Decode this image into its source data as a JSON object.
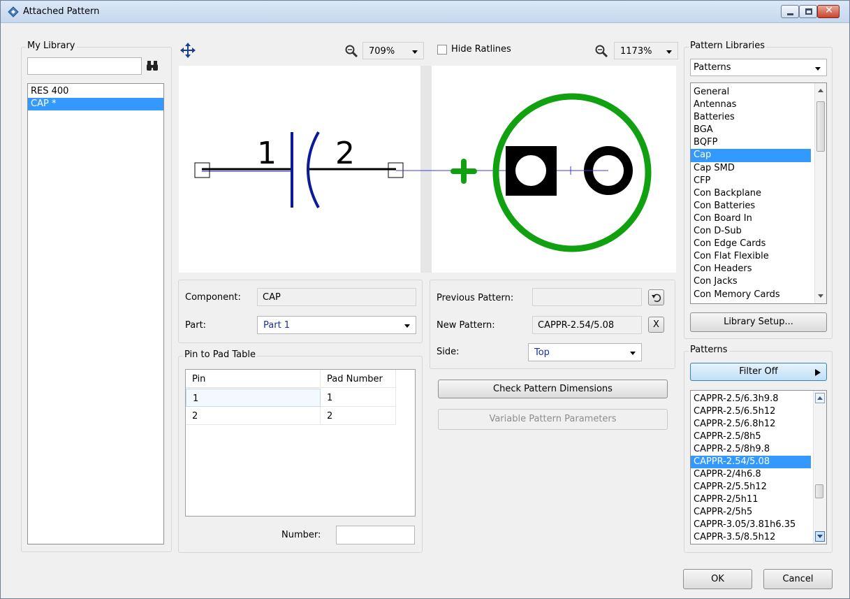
{
  "window": {
    "title": "Attached Pattern"
  },
  "my_library": {
    "group_label": "My Library",
    "search_value": "",
    "items": [
      {
        "label": "RES 400",
        "selected": false
      },
      {
        "label": "CAP *",
        "selected": true
      }
    ]
  },
  "toolbar": {
    "left_zoom": "709%",
    "hide_ratlines_label": "Hide Ratlines",
    "hide_ratlines_checked": false,
    "right_zoom": "1173%"
  },
  "schematic": {
    "pin1_label": "1",
    "pin2_label": "2"
  },
  "component_panel": {
    "component_label": "Component:",
    "component_value": "CAP",
    "part_label": "Part:",
    "part_value": "Part 1"
  },
  "pin_table": {
    "group_label": "Pin to Pad Table",
    "columns": [
      "Pin",
      "Pad Number"
    ],
    "rows": [
      {
        "pin": "1",
        "pad": "1"
      },
      {
        "pin": "2",
        "pad": "2"
      }
    ],
    "number_label": "Number:",
    "number_value": ""
  },
  "pattern_panel": {
    "previous_label": "Previous Pattern:",
    "previous_value": "",
    "new_label": "New Pattern:",
    "new_value": "CAPPR-2.54/5.08",
    "clear_label": "X",
    "side_label": "Side:",
    "side_value": "Top",
    "check_button": "Check Pattern Dimensions",
    "variable_button": "Variable Pattern Parameters"
  },
  "pattern_libraries": {
    "group_label": "Pattern Libraries",
    "selected_library": "Patterns",
    "items": [
      {
        "label": "General",
        "selected": false
      },
      {
        "label": "Antennas",
        "selected": false
      },
      {
        "label": "Batteries",
        "selected": false
      },
      {
        "label": "BGA",
        "selected": false
      },
      {
        "label": "BQFP",
        "selected": false
      },
      {
        "label": "Cap",
        "selected": true
      },
      {
        "label": "Cap SMD",
        "selected": false
      },
      {
        "label": "CFP",
        "selected": false
      },
      {
        "label": "Con Backplane",
        "selected": false
      },
      {
        "label": "Con Batteries",
        "selected": false
      },
      {
        "label": "Con Board In",
        "selected": false
      },
      {
        "label": "Con D-Sub",
        "selected": false
      },
      {
        "label": "Con Edge Cards",
        "selected": false
      },
      {
        "label": "Con Flat Flexible",
        "selected": false
      },
      {
        "label": "Con Headers",
        "selected": false
      },
      {
        "label": "Con Jacks",
        "selected": false
      },
      {
        "label": "Con Memory Cards",
        "selected": false
      }
    ],
    "setup_button": "Library Setup..."
  },
  "patterns": {
    "group_label": "Patterns",
    "filter_button": "Filter Off",
    "items": [
      {
        "label": "CAPPR-2.5/6.3h9.8",
        "selected": false
      },
      {
        "label": "CAPPR-2.5/6.5h12",
        "selected": false
      },
      {
        "label": "CAPPR-2.5/6.8h12",
        "selected": false
      },
      {
        "label": "CAPPR-2.5/8h5",
        "selected": false
      },
      {
        "label": "CAPPR-2.5/8h9.8",
        "selected": false
      },
      {
        "label": "CAPPR-2.54/5.08",
        "selected": true
      },
      {
        "label": "CAPPR-2/4h6.8",
        "selected": false
      },
      {
        "label": "CAPPR-2/5.5h12",
        "selected": false
      },
      {
        "label": "CAPPR-2/5h11",
        "selected": false
      },
      {
        "label": "CAPPR-2/5h5",
        "selected": false
      },
      {
        "label": "CAPPR-3.05/3.81h6.35",
        "selected": false
      },
      {
        "label": "CAPPR-3.5/8.5h12",
        "selected": false
      }
    ]
  },
  "footer": {
    "ok": "OK",
    "cancel": "Cancel"
  },
  "colors": {
    "selection": "#3399ff",
    "schematic_line": "#000000",
    "schematic_cap": "#0a1a9a",
    "ratline": "#3b3bd6",
    "silkscreen": "#10a010",
    "pad": "#000000"
  }
}
